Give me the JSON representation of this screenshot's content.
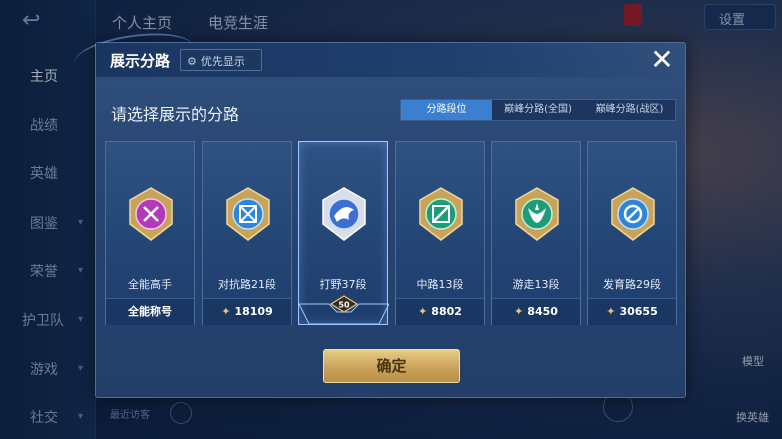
{
  "background": {
    "top_tabs": [
      "个人主页",
      "电竞生涯"
    ],
    "settings_label": "设置",
    "sidebar_items": [
      "主页",
      "战绩",
      "英雄",
      "图鉴",
      "荣誉",
      "护卫队",
      "游戏",
      "社交"
    ],
    "recent_visitors_label": "最近访客",
    "model_label": "模型",
    "change_hero_label": "换英雄"
  },
  "dialog": {
    "title": "展示分路",
    "priority_button": "优先显示",
    "subtitle": "请选择展示的分路",
    "filter_tabs": [
      "分路段位",
      "巅峰分路(全国)",
      "巅峰分路(战区)"
    ],
    "active_filter": 0,
    "confirm_label": "确定"
  },
  "cards": [
    {
      "label": "全能高手",
      "value": "全能称号",
      "icon": "all-round-emblem",
      "color": "#b23ab8"
    },
    {
      "label": "对抗路21段",
      "value": "18109",
      "icon": "clash-lane-emblem",
      "color": "#2e86d8"
    },
    {
      "label": "打野37段",
      "value": "50",
      "icon": "jungle-emblem",
      "color": "#3b6fd0",
      "selected": true
    },
    {
      "label": "中路13段",
      "value": "8802",
      "icon": "mid-lane-emblem",
      "color": "#1e9c78"
    },
    {
      "label": "游走13段",
      "value": "8450",
      "icon": "roam-emblem",
      "color": "#1e9c78"
    },
    {
      "label": "发育路29段",
      "value": "30655",
      "icon": "farm-lane-emblem",
      "color": "#2e86d8"
    }
  ],
  "colors": {
    "accent": "#3b7fd0",
    "confirm": "#caa35b",
    "dialog_bg": "#284573"
  }
}
